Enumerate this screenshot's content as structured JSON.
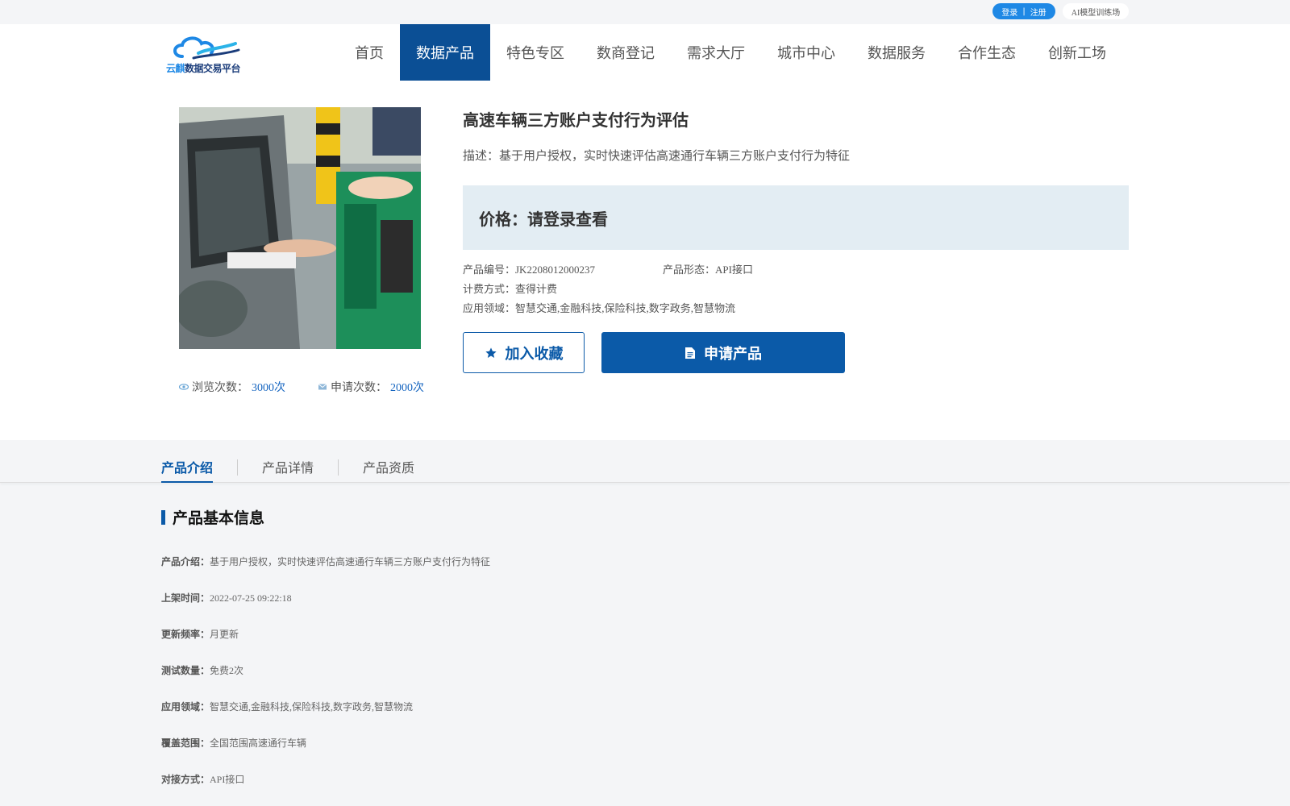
{
  "topbar": {
    "login": "登录",
    "sep": "|",
    "register": "注册",
    "ai": "AI模型训练场"
  },
  "logo": {
    "brand_a": "云麒",
    "brand_b": "数据交易平台"
  },
  "nav": [
    "首页",
    "数据产品",
    "特色专区",
    "数商登记",
    "需求大厅",
    "城市中心",
    "数据服务",
    "合作生态",
    "创新工场"
  ],
  "nav_active": "数据产品",
  "product": {
    "title": "高速车辆三方账户支付行为评估",
    "desc": "描述：基于用户授权，实时快速评估高速通行车辆三方账户支付行为特征",
    "price": "价格：请登录查看",
    "code": "产品编号：JK2208012000237",
    "form": "产品形态：API接口",
    "billing": "计费方式：查得计费",
    "domain": "应用领域：智慧交通,金融科技,保险科技,数字政务,智慧物流",
    "views_label": "浏览次数：",
    "views": "3000次",
    "applies_label": "申请次数：",
    "applies": "2000次",
    "fav_btn": "加入收藏",
    "apply_btn": "申请产品"
  },
  "tabs": [
    "产品介绍",
    "产品详情",
    "产品资质"
  ],
  "section": {
    "title": "产品基本信息",
    "rows": [
      {
        "k": "产品介绍：",
        "v": "基于用户授权，实时快速评估高速通行车辆三方账户支付行为特征"
      },
      {
        "k": "上架时间：",
        "v": "2022-07-25 09:22:18"
      },
      {
        "k": "更新频率：",
        "v": "月更新"
      },
      {
        "k": "测试数量：",
        "v": "免费2次"
      },
      {
        "k": "应用领域：",
        "v": "智慧交通,金融科技,保险科技,数字政务,智慧物流"
      },
      {
        "k": "覆盖范围：",
        "v": "全国范围高速通行车辆"
      },
      {
        "k": "对接方式：",
        "v": "API接口"
      }
    ]
  },
  "colors": {
    "primary": "#0b5aa8",
    "nav_active": "#0b4f95",
    "price_bg": "#e3edf3",
    "pill": "#1e88e5"
  }
}
